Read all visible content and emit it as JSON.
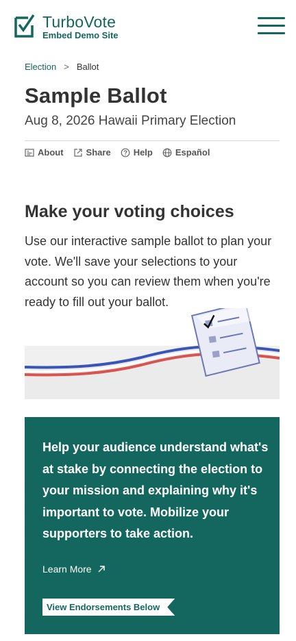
{
  "brand": {
    "title": "TurboVote",
    "subtitle": "Embed Demo Site",
    "logo_icon": "checkbox-logo-icon",
    "color": "#14675e"
  },
  "menu": {
    "icon": "hamburger-menu-icon"
  },
  "breadcrumb": {
    "link": "Election",
    "separator": ">",
    "current": "Ballot"
  },
  "page": {
    "title": "Sample Ballot",
    "subtitle": "Aug 8, 2026 Hawaii Primary Election"
  },
  "actions": [
    {
      "label": "About",
      "icon": "info-card-icon"
    },
    {
      "label": "Share",
      "icon": "share-icon"
    },
    {
      "label": "Help",
      "icon": "help-circle-icon"
    },
    {
      "label": "Español",
      "icon": "globe-icon"
    }
  ],
  "intro": {
    "title": "Make your voting choices",
    "description": "Use our interactive sample ballot to plan your vote. We'll save your selections to your account so you can review them when you're ready to fill out your ballot."
  },
  "promo": {
    "text": "Help your audience understand what's at stake by connecting the election to your mission and explaining why it's important to vote. Mobilize your supporters to take action.",
    "learn_more": "Learn More",
    "endorse_button": "View Endorsements Below",
    "background": "#14675e"
  }
}
